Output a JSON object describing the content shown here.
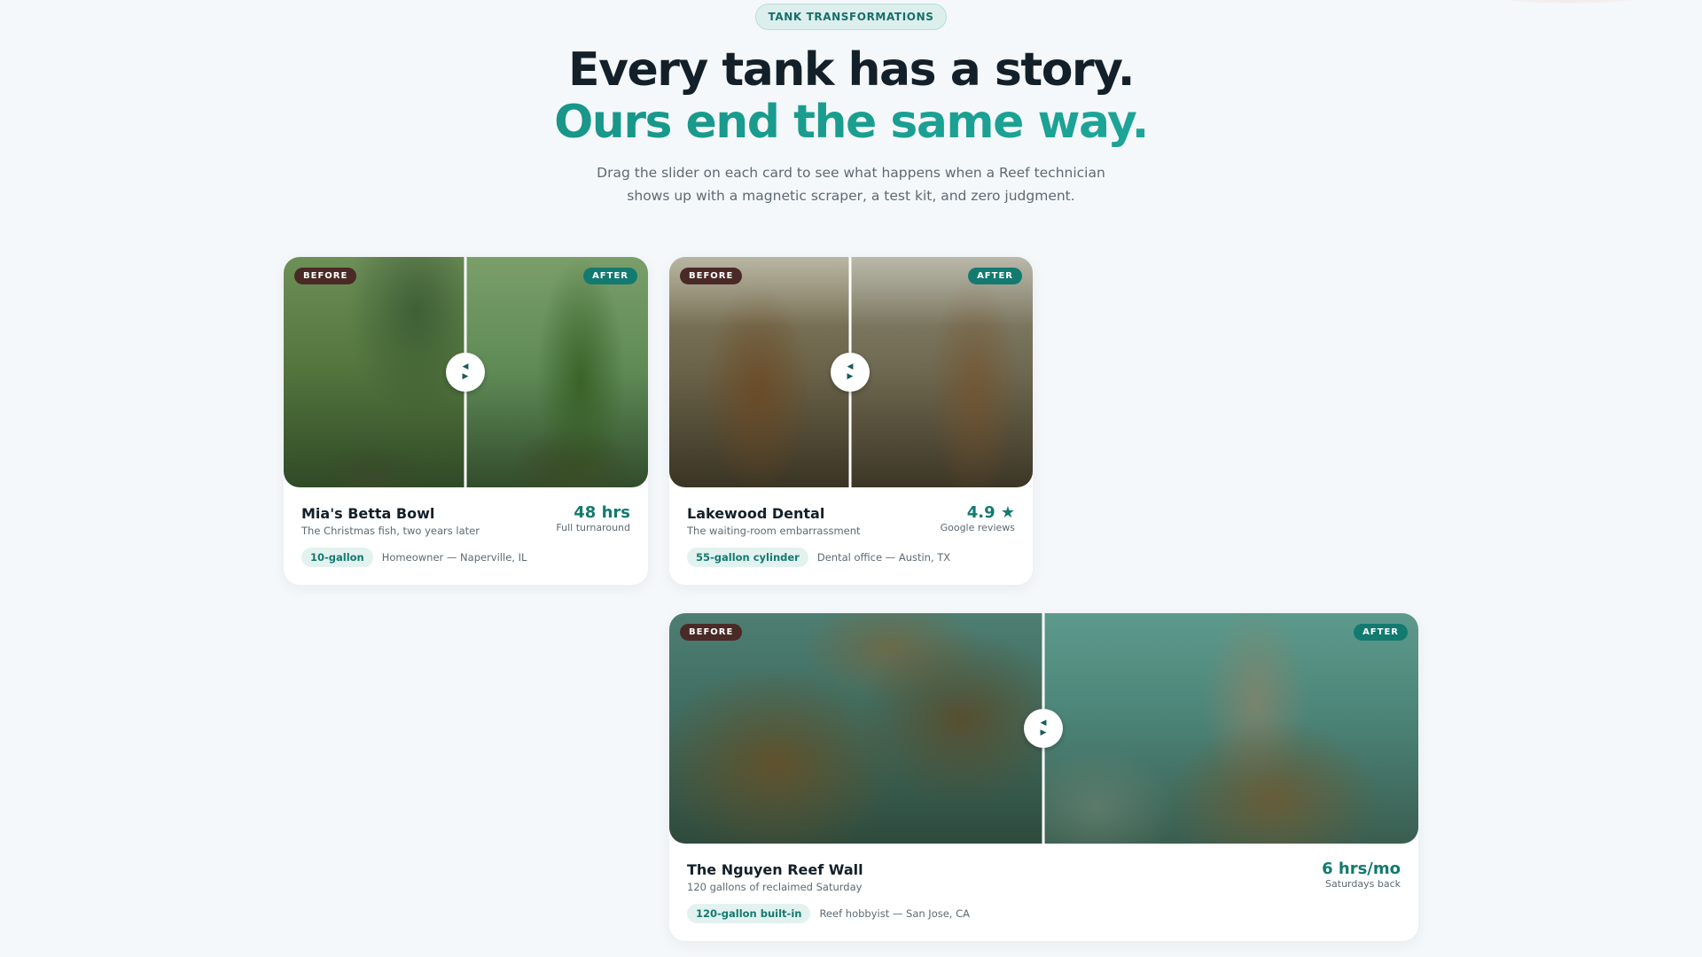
{
  "eyebrow": "TANK TRANSFORMATIONS",
  "headline": {
    "line1": "Every tank has a story.",
    "line2": "Ours end the same way."
  },
  "subhead": "Drag the slider on each card to see what happens when a Reef technician shows up with a magnetic scraper, a test kit, and zero judgment.",
  "labels": {
    "before": "BEFORE",
    "after": "AFTER"
  },
  "handle_icons": [
    "chevron-left-icon",
    "chevron-right-icon"
  ],
  "colors": {
    "accent": "#137a70",
    "before_tag": "#4a2a26",
    "headline_dark": "#13202a"
  },
  "cards": [
    {
      "title": "Mia's Betta Bowl",
      "description": "The Christmas fish, two years later",
      "stat_value": "48 hrs",
      "stat_label": "Full turnaround",
      "size": "10-gallon",
      "location": "Homeowner — Naperville, IL",
      "slider_position": 0.5
    },
    {
      "title": "Lakewood Dental",
      "description": "The waiting-room embarrassment",
      "stat_value": "4.9 ★",
      "stat_label": "Google reviews",
      "size": "55-gallon cylinder",
      "location": "Dental office — Austin, TX",
      "slider_position": 0.5
    },
    {
      "title": "The Nguyen Reef Wall",
      "description": "120 gallons of reclaimed Saturday",
      "stat_value": "6 hrs/mo",
      "stat_label": "Saturdays back",
      "size": "120-gallon built-in",
      "location": "Reef hobbyist — San Jose, CA",
      "slider_position": 0.5
    }
  ]
}
